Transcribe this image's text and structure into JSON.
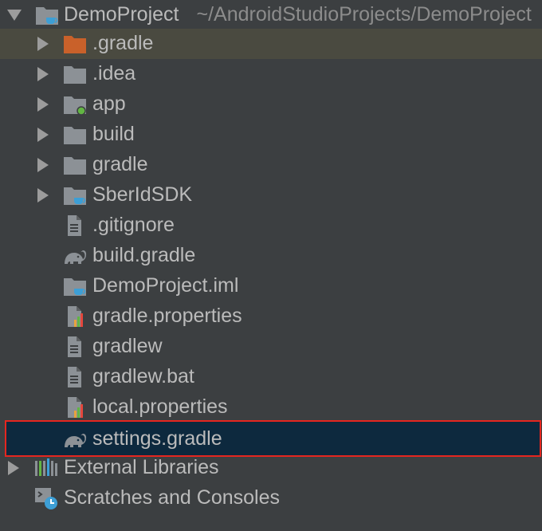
{
  "tree": {
    "root": {
      "name": "DemoProject",
      "path": "~/AndroidStudioProjects/DemoProject",
      "icon": "project-folder-icon",
      "expanded": true
    },
    "items": [
      {
        "label": ".gradle",
        "icon": "folder-orange-icon",
        "expandable": true
      },
      {
        "label": ".idea",
        "icon": "folder-icon",
        "expandable": true
      },
      {
        "label": "app",
        "icon": "module-folder-icon",
        "expandable": true
      },
      {
        "label": "build",
        "icon": "folder-icon",
        "expandable": true
      },
      {
        "label": "gradle",
        "icon": "folder-icon",
        "expandable": true
      },
      {
        "label": "SberIdSDK",
        "icon": "module-folder-cup-icon",
        "expandable": true
      },
      {
        "label": ".gitignore",
        "icon": "text-file-icon",
        "expandable": false
      },
      {
        "label": "build.gradle",
        "icon": "gradle-elephant-icon",
        "expandable": false
      },
      {
        "label": "DemoProject.iml",
        "icon": "iml-file-icon",
        "expandable": false
      },
      {
        "label": "gradle.properties",
        "icon": "properties-file-icon",
        "expandable": false
      },
      {
        "label": "gradlew",
        "icon": "text-file-icon",
        "expandable": false
      },
      {
        "label": "gradlew.bat",
        "icon": "text-file-icon",
        "expandable": false
      },
      {
        "label": "local.properties",
        "icon": "properties-file-icon",
        "expandable": false
      },
      {
        "label": "settings.gradle",
        "icon": "gradle-elephant-icon",
        "expandable": false,
        "selected": true
      }
    ],
    "external_libraries": {
      "label": "External Libraries",
      "icon": "libraries-icon"
    },
    "scratches": {
      "label": "Scratches and Consoles",
      "icon": "scratches-icon"
    }
  },
  "colors": {
    "background": "#3c3f41",
    "text": "#bbbbbb",
    "selection": "#0d293e",
    "selection_border": "#e5261f",
    "gradle_row": "#4a4a40",
    "folder": "#8c9196",
    "folder_orange": "#c9612a",
    "cup": "#3d9fd6",
    "module_dot": "#62b543"
  }
}
